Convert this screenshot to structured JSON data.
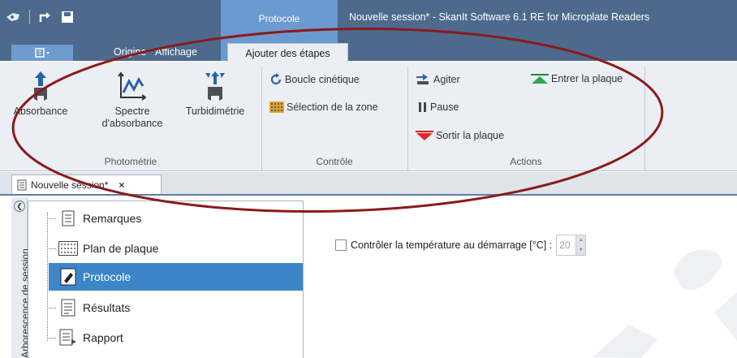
{
  "app": {
    "window_title": "Nouvelle session* - SkanIt Software 6.1 RE for Microplate Readers",
    "context_tab": "Protocole"
  },
  "quick_access": {
    "icons": [
      "app-logo-icon",
      "undo-icon",
      "save-icon"
    ]
  },
  "ribbon_tabs": [
    {
      "label": "Origine"
    },
    {
      "label": "Affichage"
    },
    {
      "label": "Ajouter des étapes",
      "active": true
    }
  ],
  "ribbon": {
    "photometry": {
      "label": "Photométrie",
      "buttons": [
        {
          "label": "Absorbance"
        },
        {
          "label": "Spectre",
          "label2": "d'absorbance"
        },
        {
          "label": "Turbidimétrie"
        }
      ]
    },
    "control": {
      "label": "Contrôle",
      "buttons": [
        {
          "label": "Boucle cinétique"
        },
        {
          "label": "Sélection de la zone"
        }
      ]
    },
    "actions": {
      "label": "Actions",
      "buttons": [
        {
          "label": "Agiter"
        },
        {
          "label": "Pause"
        },
        {
          "label": "Sortir la plaque"
        },
        {
          "label": "Entrer la plaque"
        }
      ]
    }
  },
  "document_tab": {
    "label": "Nouvelle session*",
    "close": "×"
  },
  "sidebar": {
    "title": "Arborescence de session",
    "items": [
      {
        "label": "Remarques",
        "icon": "notes-icon"
      },
      {
        "label": "Plan de plaque",
        "icon": "plate-layout-icon"
      },
      {
        "label": "Protocole",
        "icon": "protocol-icon",
        "selected": true
      },
      {
        "label": "Résultats",
        "icon": "results-icon"
      },
      {
        "label": "Rapport",
        "icon": "report-icon"
      }
    ]
  },
  "main": {
    "temperature_label": "Contrôler la température au démarrage [°C] :",
    "temperature_value": "20",
    "temperature_checked": false
  },
  "colors": {
    "titlebar": "#4d6a8d",
    "context_tab": "#6b9ad0",
    "selection": "#3c86c8",
    "annotation": "#8b1a1a"
  }
}
